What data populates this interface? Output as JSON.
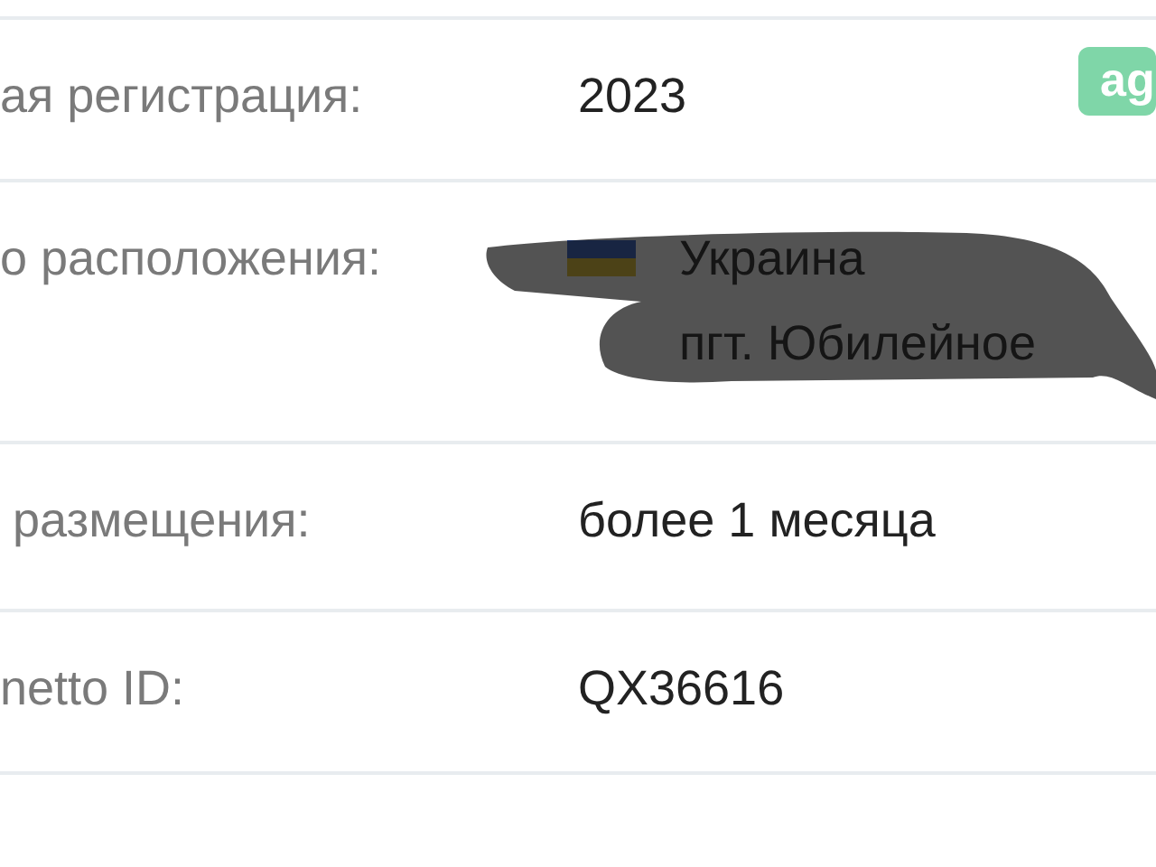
{
  "badge": "ag",
  "rows": [
    {
      "label": "ая регистрация:",
      "values": [
        "2023"
      ]
    },
    {
      "label": "о расположения:",
      "flag": true,
      "values": [
        "Украина",
        "пгт. Юбилейное"
      ],
      "redacted": true
    },
    {
      "label": "размещения:",
      "values": [
        "более 1 месяца"
      ]
    },
    {
      "label": "netto ID:",
      "values": [
        "QX36616"
      ]
    }
  ]
}
